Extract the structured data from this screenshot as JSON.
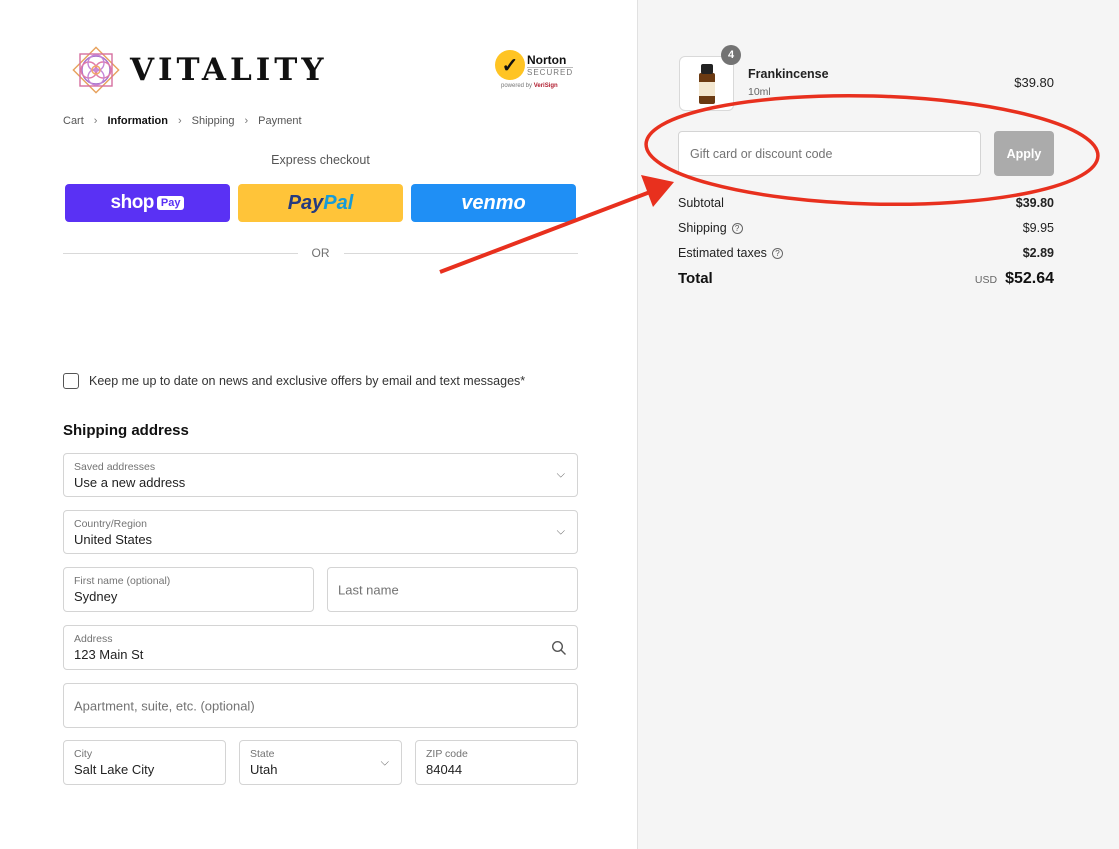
{
  "brand": {
    "name": "VITALITY"
  },
  "norton": {
    "name": "Norton",
    "secured": "SECURED",
    "powered_prefix": "powered by",
    "verisign": "VeriSign"
  },
  "breadcrumb": {
    "items": [
      "Cart",
      "Information",
      "Shipping",
      "Payment"
    ],
    "active": "Information"
  },
  "express": {
    "title": "Express checkout",
    "shoppay": {
      "brand": "shop",
      "tag": "Pay"
    },
    "paypal": {
      "part1": "Pay",
      "part2": "Pal"
    },
    "venmo": "venmo",
    "or": "OR"
  },
  "newsletter": {
    "label": "Keep me up to date on news and exclusive offers by email and text messages*",
    "checked": false
  },
  "shipping": {
    "title": "Shipping address",
    "saved": {
      "label": "Saved addresses",
      "value": "Use a new address"
    },
    "country": {
      "label": "Country/Region",
      "value": "United States"
    },
    "first_name": {
      "label": "First name (optional)",
      "value": "Sydney"
    },
    "last_name": {
      "placeholder": "Last name"
    },
    "address": {
      "label": "Address",
      "value": "123 Main St"
    },
    "apartment": {
      "placeholder": "Apartment, suite, etc. (optional)"
    },
    "city": {
      "label": "City",
      "value": "Salt Lake City"
    },
    "state": {
      "label": "State",
      "value": "Utah"
    },
    "zip": {
      "label": "ZIP code",
      "value": "84044"
    }
  },
  "order": {
    "item": {
      "name": "Frankincense",
      "variant": "10ml",
      "price": "$39.80",
      "quantity": "4"
    },
    "discount": {
      "placeholder": "Gift card or discount code",
      "apply": "Apply"
    },
    "subtotal": {
      "label": "Subtotal",
      "value": "$39.80"
    },
    "shipping": {
      "label": "Shipping",
      "value": "$9.95"
    },
    "taxes": {
      "label": "Estimated taxes",
      "value": "$2.89"
    },
    "total": {
      "label": "Total",
      "currency": "USD",
      "value": "$52.64"
    }
  },
  "colors": {
    "annotation": "#e8301e",
    "shoppay": "#5a31f4",
    "paypal": "#ffc439",
    "venmo": "#1f8ff5",
    "apply_disabled": "#ababab"
  }
}
